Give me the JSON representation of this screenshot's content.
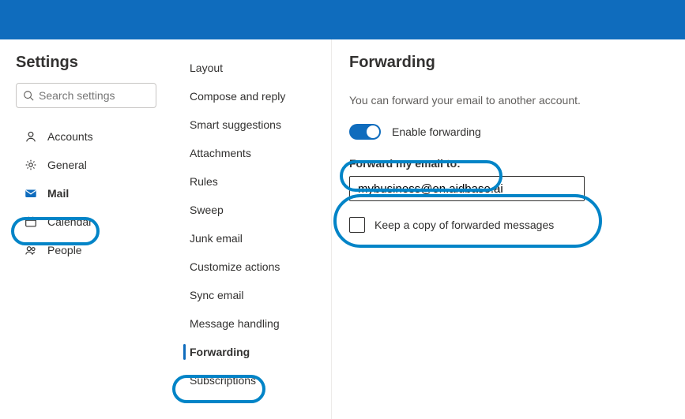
{
  "header": {
    "title": "Settings"
  },
  "search": {
    "placeholder": "Search settings"
  },
  "nav": {
    "items": [
      {
        "label": "Accounts"
      },
      {
        "label": "General"
      },
      {
        "label": "Mail"
      },
      {
        "label": "Calendar"
      },
      {
        "label": "People"
      }
    ]
  },
  "subnav": {
    "items": [
      {
        "label": "Layout"
      },
      {
        "label": "Compose and reply"
      },
      {
        "label": "Smart suggestions"
      },
      {
        "label": "Attachments"
      },
      {
        "label": "Rules"
      },
      {
        "label": "Sweep"
      },
      {
        "label": "Junk email"
      },
      {
        "label": "Customize actions"
      },
      {
        "label": "Sync email"
      },
      {
        "label": "Message handling"
      },
      {
        "label": "Forwarding"
      },
      {
        "label": "Subscriptions"
      }
    ]
  },
  "pane": {
    "title": "Forwarding",
    "description": "You can forward your email to another account.",
    "toggle_label": "Enable forwarding",
    "toggle_on": true,
    "field_label": "Forward my email to:",
    "email_value": "mybusiness@on.aidbase.ai",
    "keep_copy_label": "Keep a copy of forwarded messages",
    "keep_copy_checked": false
  },
  "colors": {
    "accent": "#0f6cbd",
    "highlight": "#0284c7"
  }
}
